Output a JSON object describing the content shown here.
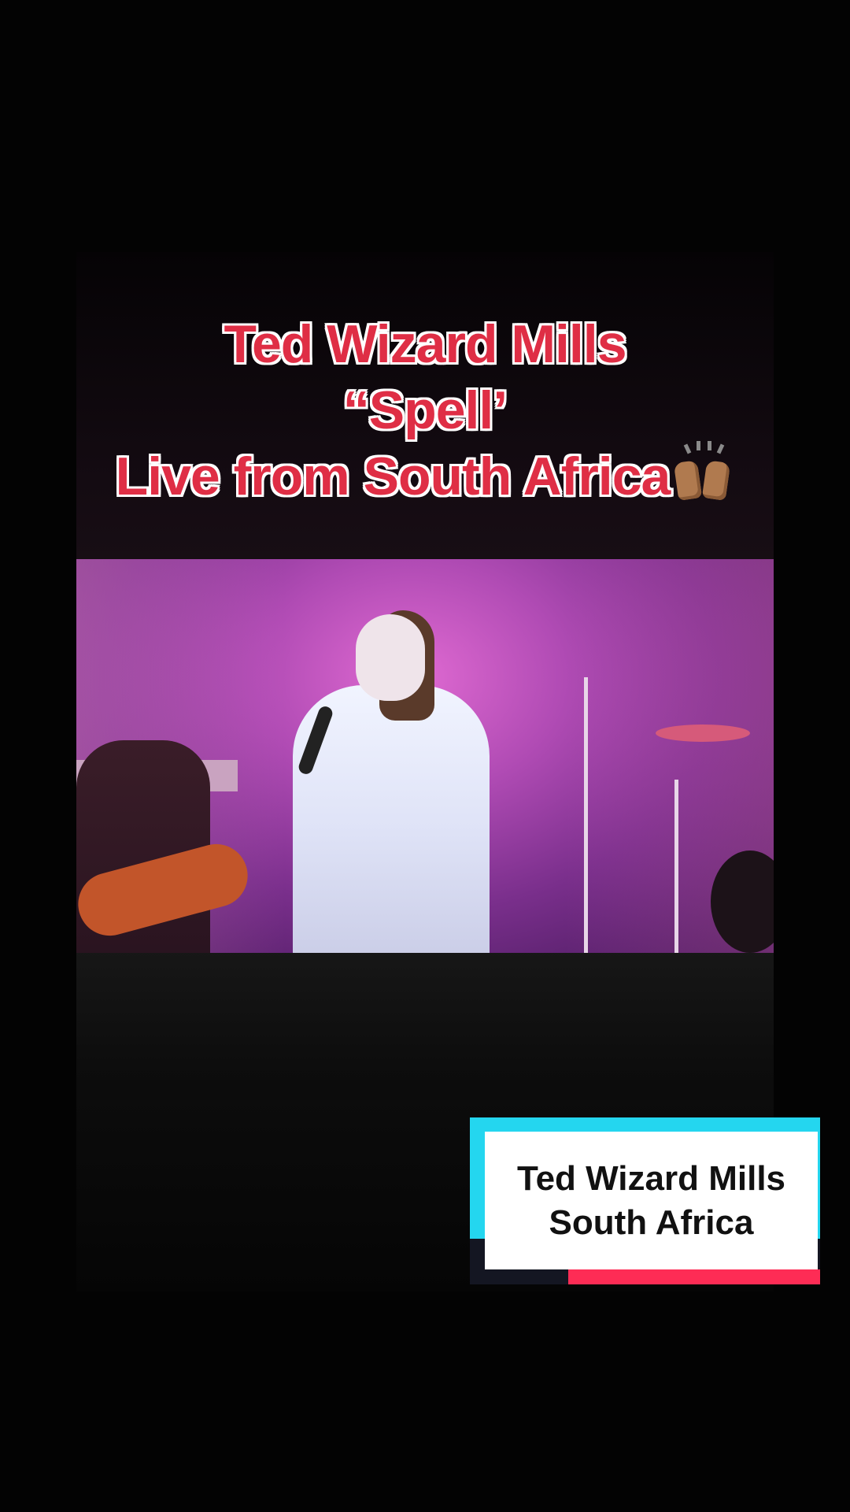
{
  "overlay_title": {
    "line1": "Ted Wizard Mills",
    "line2": "“Spell’",
    "line3": "Live from South Africa",
    "emoji": "raising-hands-emoji",
    "color": "#df2e45"
  },
  "video": {
    "icon": "concert-video-frame"
  },
  "caption_sticker": {
    "line1": "Ted Wizard Mills",
    "line2": "South Africa",
    "accent_cyan": "#24d6ef",
    "accent_red": "#fe2c55"
  }
}
